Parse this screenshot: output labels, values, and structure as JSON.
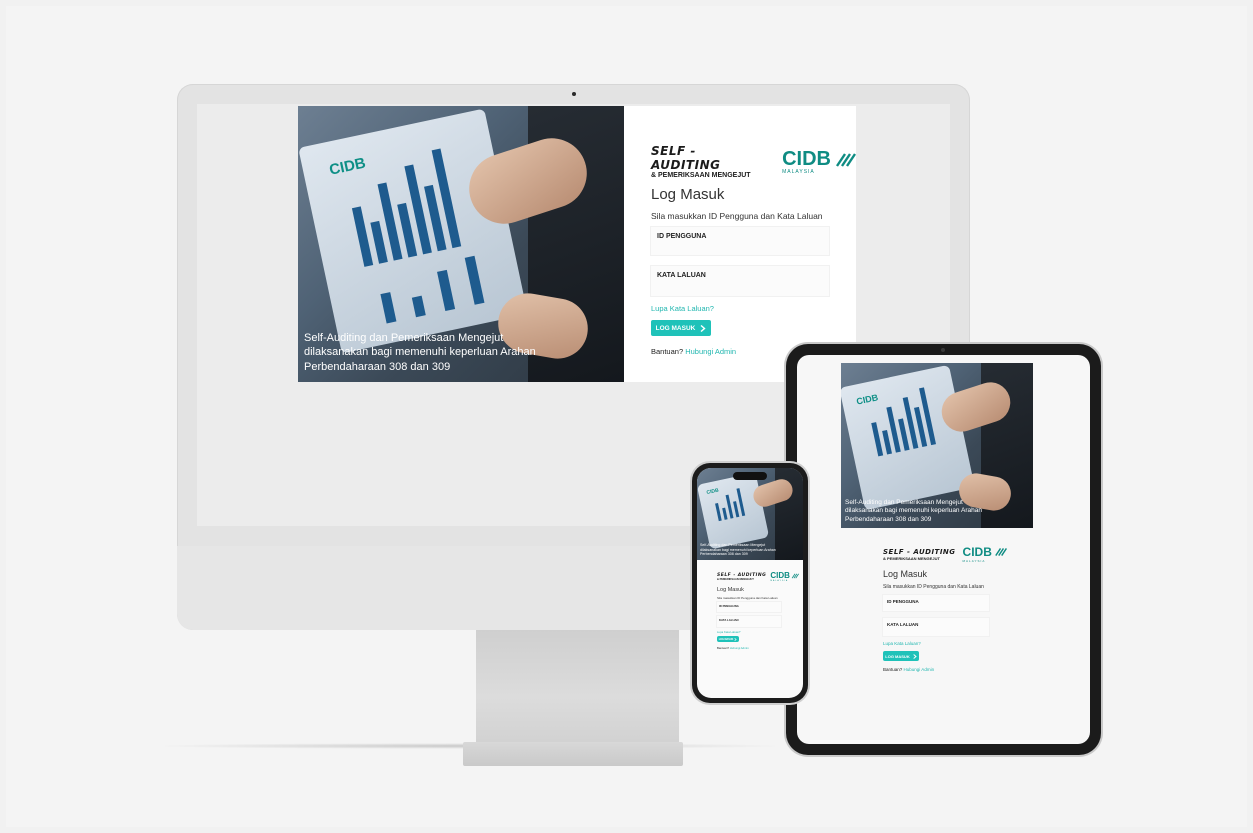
{
  "brand": {
    "line1": "SELF - AUDITING",
    "line2": "& PEMERIKSAAN MENGEJUT",
    "logo": "CIDB",
    "logo_sub": "MALAYSIA"
  },
  "login": {
    "title": "Log Masuk",
    "subtitle": "Sila masukkan ID Pengguna dan Kata Laluan",
    "id_label": "ID PENGGUNA",
    "password_label": "KATA LALUAN",
    "forgot_link": "Lupa Kata Laluan?",
    "submit_label": "LOG MASUK",
    "help_text": "Bantuan?",
    "help_link": "Hubungi Admin"
  },
  "photo": {
    "caption": "Self-Auditing dan Pemeriksaan Mengejut dilaksanakan bagi memenuhi keperluan Arahan Perbendaharaan 308 dan 309",
    "mini_logo": "CIDB"
  },
  "colors": {
    "accent": "#1fc2b9",
    "brand_green": "#0f8c83",
    "link": "#22b7b0"
  },
  "icons": {
    "submit_arrow": "chevron-right-icon",
    "cidb_mark": "cidb-logo-icon"
  }
}
